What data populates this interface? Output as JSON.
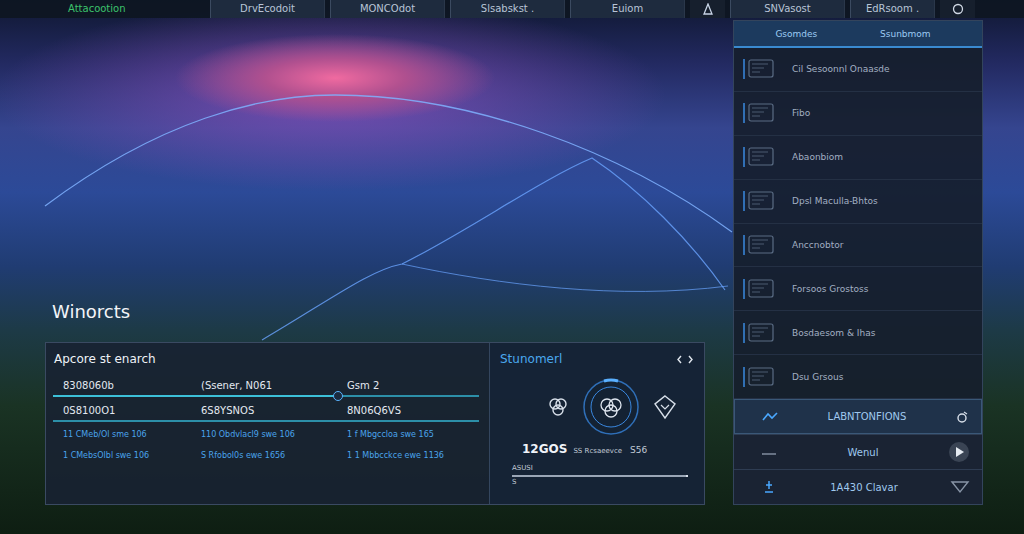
{
  "topbar": {
    "brand": "Attacootion",
    "left_items": [
      {
        "label": "DrvEcodoit"
      },
      {
        "label": "MONCOdot"
      },
      {
        "label": "Slsabskst ."
      },
      {
        "label": "Euiom"
      }
    ],
    "right_items": [
      {
        "label": "SNVasost"
      },
      {
        "label": "EdRsoom ."
      }
    ]
  },
  "title": "Winorcts",
  "console": {
    "title": "Apcore st enarch",
    "rows": [
      {
        "cells": [
          "8308060b",
          "(Ssener, N061",
          "Gsm 2"
        ],
        "kind": "slider",
        "level": 0.67
      },
      {
        "cells": [
          "0S8100O1",
          "6S8YSNOS",
          "8N06Q6VS"
        ],
        "kind": "plain"
      },
      {
        "cells": [
          "11 CMeb/Ol sme 106",
          "110 Obdvlacl9 swe 106",
          "1 f Mbgccloa swe 165"
        ],
        "kind": "detail"
      },
      {
        "cells": [
          "1 CMebsOlbl swe 106",
          "S Rfobol0s ewe 1656",
          "1 1 Mbbcckce ewe 1136"
        ],
        "kind": "detail"
      }
    ]
  },
  "stunomerl": {
    "title": "Stunomerl",
    "value": "12GOS",
    "caption": "SS Rcsaeevce",
    "unit": "S56",
    "range": {
      "label": "ASUSI",
      "value": "S",
      "level": 1
    }
  },
  "side": {
    "tabs": [
      "Gsomdes",
      "Ssunbmom"
    ],
    "items": [
      "Cil Sesoonnl Onaasde",
      "Fibo",
      "Abaonbiom",
      "Dpsl Maculla-Bhtos",
      "Anccnobtor",
      "Forsoos Grostoss",
      "Bosdaesom & Ihas",
      "Dsu Grsous"
    ],
    "actions": [
      {
        "label": "LABNTONFIONS",
        "selected": true,
        "kind": "toggle"
      },
      {
        "label": "Wenul",
        "selected": false,
        "kind": "play"
      },
      {
        "label": "1A430 Clavar",
        "selected": false,
        "kind": "info"
      }
    ]
  }
}
